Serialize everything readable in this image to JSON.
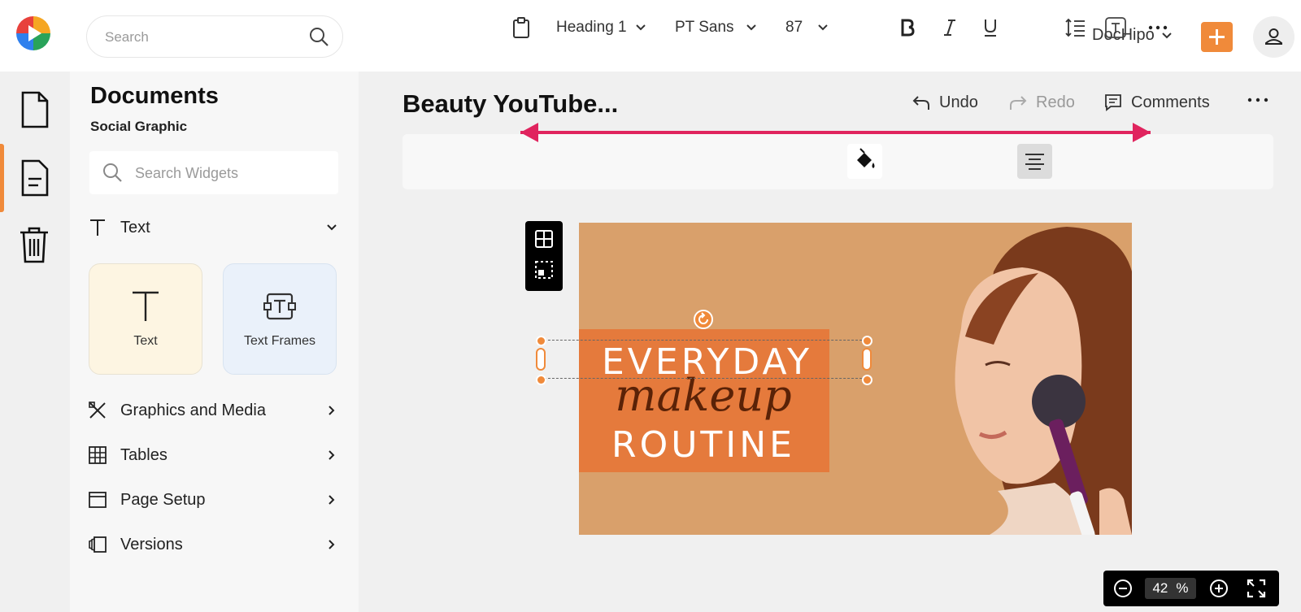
{
  "header": {
    "search_placeholder": "Search",
    "account_name": "DocHipo"
  },
  "sidebar": {
    "rail": [
      "document-icon",
      "document-lines-icon",
      "trash-icon"
    ]
  },
  "panel": {
    "title": "Documents",
    "subtitle": "Social Graphic",
    "search_placeholder": "Search Widgets",
    "text_section": "Text",
    "cards": [
      {
        "label": "Text"
      },
      {
        "label": "Text Frames"
      }
    ],
    "sections": [
      {
        "label": "Graphics and Media"
      },
      {
        "label": "Tables"
      },
      {
        "label": "Page Setup"
      },
      {
        "label": "Versions"
      }
    ]
  },
  "editor": {
    "doc_title": "Beauty YouTube...",
    "undo_label": "Undo",
    "redo_label": "Redo",
    "comments_label": "Comments",
    "toolbar": {
      "style": "Heading 1",
      "font": "PT Sans",
      "size": "87"
    },
    "canvas": {
      "line1": "EVERYDAY",
      "line2": "makeup",
      "line3": "ROUTINE"
    },
    "zoom": {
      "value": "42",
      "unit": "%"
    }
  },
  "colors": {
    "accent": "#f08a3a",
    "canvas_bg": "#d9a06b",
    "banner": "#e57a3c",
    "arrow": "#e0245e"
  }
}
